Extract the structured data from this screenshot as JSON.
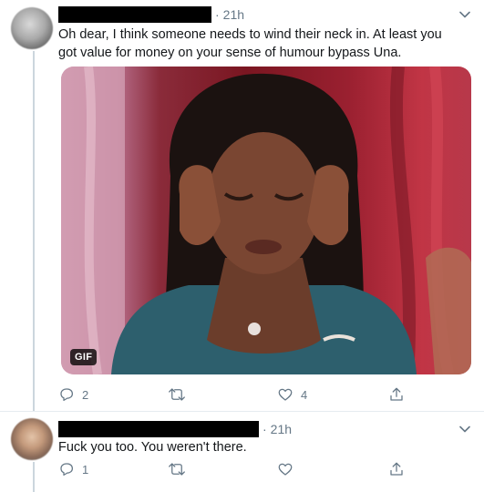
{
  "tweets": [
    {
      "time": "21h",
      "text": "Oh dear, I think someone needs to wind their neck in. At least you got value for money on your sense of humour bypass Una.",
      "media": {
        "badge": "GIF"
      },
      "actions": {
        "replies": "2",
        "retweets": "",
        "likes": "4"
      }
    },
    {
      "time": "21h",
      "text": "Fuck you too. You weren't there.",
      "actions": {
        "replies": "1",
        "retweets": "",
        "likes": ""
      }
    }
  ],
  "colors": {
    "muted": "#657786",
    "thread_line": "#ccd6dd",
    "divider": "#e6ecf0"
  },
  "icons": [
    "reply-icon",
    "retweet-icon",
    "like-icon",
    "share-icon",
    "chevron-down-icon"
  ]
}
